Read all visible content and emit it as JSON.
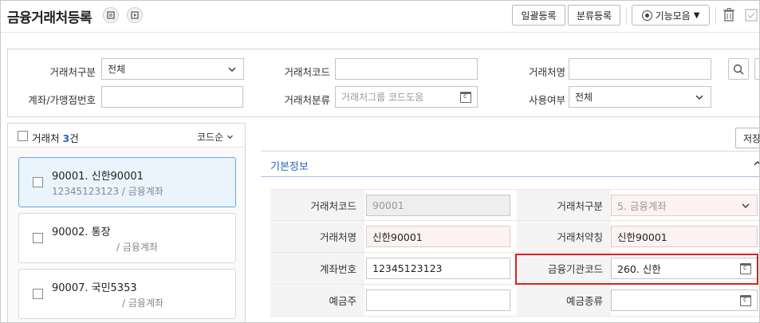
{
  "header": {
    "title": "금융거래처등록",
    "bulk_register": "일괄등록",
    "category_register": "분류등록",
    "features": "기능모음"
  },
  "search": {
    "type_label": "거래처구분",
    "type_value": "전체",
    "code_label": "거래처코드",
    "code_value": "",
    "name_label": "거래처명",
    "name_value": "",
    "account_label": "계좌/가맹점번호",
    "account_value": "",
    "category_label": "거래처분류",
    "category_placeholder": "거래처그룹 코드도움",
    "usage_label": "사용여부",
    "usage_value": "전체"
  },
  "list": {
    "header_label": "거래처",
    "count": "3",
    "count_unit": "건",
    "sort": "코드순",
    "items": [
      {
        "title": "90001. 신한90001",
        "sub": "12345123123 / 금융계좌"
      },
      {
        "title": "90002. 통장",
        "sub": "/ 금융계좌"
      },
      {
        "title": "90007. 국민5353",
        "sub": "/ 금융계좌"
      }
    ]
  },
  "detail": {
    "save": "저장",
    "tab": "기본정보",
    "code_label": "거래처코드",
    "code_value": "90001",
    "type_label": "거래처구분",
    "type_value": "5. 금융계좌",
    "name_label": "거래처명",
    "name_value": "신한90001",
    "short_label": "거래처약칭",
    "short_value": "신한90001",
    "account_label": "계좌번호",
    "account_value": "12345123123",
    "bank_label": "금융기관코드",
    "bank_value": "260. 신한",
    "holder_label": "예금주",
    "holder_value": "",
    "deposit_label": "예금종류",
    "deposit_value": ""
  },
  "colors": {
    "accent": "#2a63b8",
    "highlight": "#e02020",
    "selected_card": "#eaf4fd"
  }
}
